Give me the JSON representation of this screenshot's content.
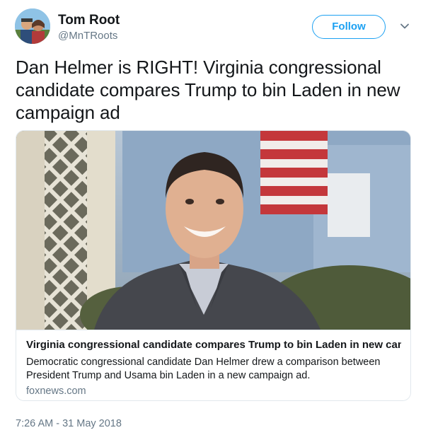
{
  "author": {
    "display_name": "Tom Root",
    "handle": "@MnTRoots",
    "avatar_icon": "profile-photo"
  },
  "actions": {
    "follow_label": "Follow",
    "menu_icon": "chevron-down-icon"
  },
  "tweet": {
    "text": "Dan Helmer is RIGHT! Virginia congressional candidate compares Trump to bin Laden in new campaign ad",
    "timestamp": "7:26 AM - 31 May 2018"
  },
  "link_card": {
    "title": "Virginia congressional candidate compares Trump to bin Laden in new camp...",
    "description": "Democratic congressional candidate Dan Helmer drew a comparison between President Trump and Usama bin Laden in a new campaign ad.",
    "domain": "foxnews.com"
  },
  "colors": {
    "accent": "#1da1f2",
    "text_primary": "#14171a",
    "text_secondary": "#657786",
    "border": "#e1e8ed"
  }
}
